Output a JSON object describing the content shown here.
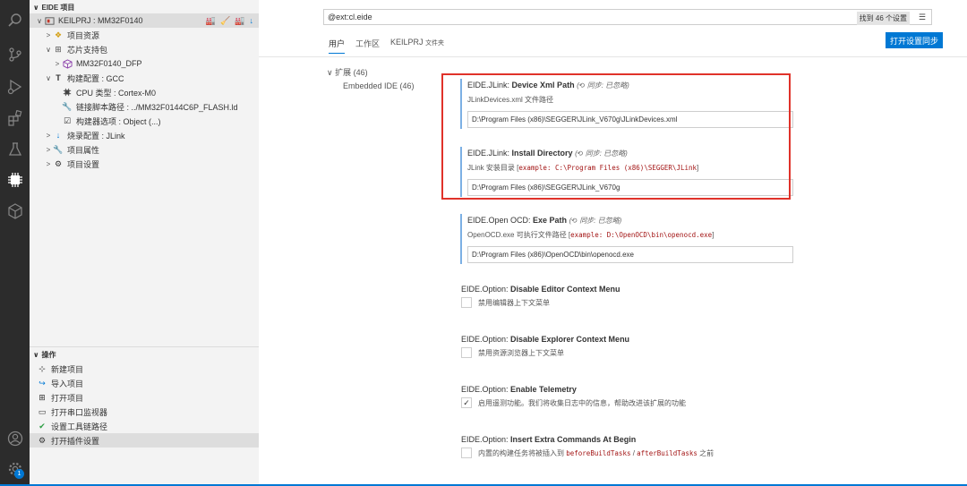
{
  "sidebar": {
    "project_section": "EIDE 项目",
    "tree": [
      {
        "label": "KEILPRJ : MM32F0140",
        "icon": "project-icon",
        "depth": 0,
        "chev": "∨"
      },
      {
        "label": "项目资源",
        "icon": "resource-icon",
        "depth": 1,
        "chev": ">"
      },
      {
        "label": "芯片支持包",
        "icon": "package-icon",
        "depth": 1,
        "chev": "∨"
      },
      {
        "label": "MM32F0140_DFP",
        "icon": "cube-icon",
        "depth": 2,
        "chev": ">"
      },
      {
        "label": "构建配置 : GCC",
        "icon": "hammer-icon",
        "depth": 1,
        "chev": "∨"
      },
      {
        "label": "CPU 类型 : Cortex-M0",
        "icon": "chip-icon",
        "depth": 2,
        "chev": ""
      },
      {
        "label": "链接脚本路径 : ../MM32F0144C6P_FLASH.ld",
        "icon": "wrench-icon",
        "depth": 2,
        "chev": ""
      },
      {
        "label": "构建器选项 : Object (...)",
        "icon": "options-icon",
        "depth": 2,
        "chev": ""
      },
      {
        "label": "烧录配置 : JLink",
        "icon": "download-icon",
        "depth": 1,
        "chev": ">"
      },
      {
        "label": "项目属性",
        "icon": "wrench-icon",
        "depth": 1,
        "chev": ">"
      },
      {
        "label": "项目设置",
        "icon": "gear-icon",
        "depth": 1,
        "chev": ">"
      }
    ],
    "ops_section": "操作",
    "ops": [
      {
        "label": "新建项目",
        "icon": "new-project-icon"
      },
      {
        "label": "导入项目",
        "icon": "import-icon"
      },
      {
        "label": "打开项目",
        "icon": "open-project-icon"
      },
      {
        "label": "打开串口监视器",
        "icon": "serial-monitor-icon"
      },
      {
        "label": "设置工具链路径",
        "icon": "check-icon"
      },
      {
        "label": "打开插件设置",
        "icon": "gear-icon"
      }
    ]
  },
  "activity": {
    "badge": "1"
  },
  "main": {
    "search_value": "@ext:cl.eide",
    "result_count": "找到 46 个设置",
    "tabs": [
      {
        "label": "用户",
        "active": true
      },
      {
        "label": "工作区",
        "active": false
      },
      {
        "label": "KEILPRJ",
        "sub": "文件夹",
        "active": false
      }
    ],
    "sync_button": "打开设置同步",
    "toc": {
      "group": "扩展 (46)",
      "item": "Embedded IDE (46)"
    }
  },
  "settings": {
    "jlink_xml": {
      "prefix": "EIDE.JLink: ",
      "name": "Device Xml Path",
      "sync": "同步: 已忽略",
      "desc": "JLinkDevices.xml 文件路径",
      "value": "D:\\Program Files (x86)\\SEGGER\\JLink_V670g\\JLinkDevices.xml"
    },
    "jlink_dir": {
      "prefix": "EIDE.JLink: ",
      "name": "Install Directory",
      "sync": "同步: 已忽略",
      "desc": "JLink 安装目录 [",
      "desc_code": "example: C:\\Program Files (x86)\\SEGGER\\JLink",
      "desc_end": "]",
      "value": "D:\\Program Files (x86)\\SEGGER\\JLink_V670g"
    },
    "openocd": {
      "prefix": "EIDE.Open OCD: ",
      "name": "Exe Path",
      "sync": "同步: 已忽略",
      "desc": "OpenOCD.exe 可执行文件路径 [",
      "desc_code": "example: D:\\OpenOCD\\bin\\openocd.exe",
      "desc_end": "]",
      "value": "D:\\Program Files (x86)\\OpenOCD\\bin\\openocd.exe"
    },
    "editor_menu": {
      "prefix": "EIDE.Option: ",
      "name": "Disable Editor Context Menu",
      "check": "禁用编辑器上下文菜单",
      "checked": false
    },
    "explorer_menu": {
      "prefix": "EIDE.Option: ",
      "name": "Disable Explorer Context Menu",
      "check": "禁用资源浏览器上下文菜单",
      "checked": false
    },
    "telemetry": {
      "prefix": "EIDE.Option: ",
      "name": "Enable Telemetry",
      "check": "启用遥测功能。我们将收集日志中的信息，帮助改进该扩展的功能",
      "checked": true
    },
    "extra_cmds": {
      "prefix": "EIDE.Option: ",
      "name": "Insert Extra Commands At Begin",
      "check": "内置的构建任务将被插入到 ",
      "code1": "beforeBuildTasks",
      "mid": " / ",
      "code2": "afterBuildTasks",
      "check_end": " 之前",
      "checked": false
    }
  }
}
